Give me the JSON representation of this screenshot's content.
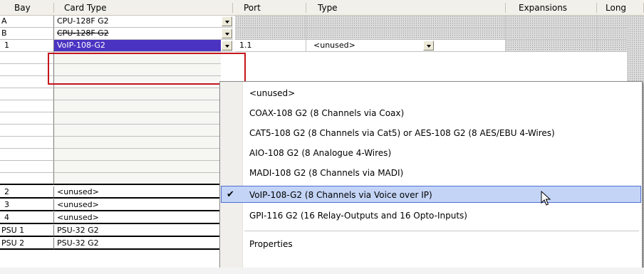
{
  "header": {
    "bay": "Bay",
    "card_type": "Card Type",
    "port": "Port",
    "type": "Type",
    "expansions": "Expansions",
    "long": "Long"
  },
  "bays": [
    {
      "bay": "A",
      "card": "CPU-128F G2"
    },
    {
      "bay": "B",
      "card": "CPU-128F G2"
    },
    {
      "bay": "1",
      "card": "VoIP-108-G2"
    },
    {
      "bay": "",
      "card": ""
    },
    {
      "bay": "",
      "card": ""
    },
    {
      "bay": "",
      "card": ""
    },
    {
      "bay": "",
      "card": ""
    },
    {
      "bay": "",
      "card": ""
    },
    {
      "bay": "",
      "card": ""
    },
    {
      "bay": "",
      "card": ""
    },
    {
      "bay": "2",
      "card": "<unused>"
    },
    {
      "bay": "3",
      "card": "<unused>"
    },
    {
      "bay": "4",
      "card": "<unused>"
    },
    {
      "bay": "PSU 1",
      "card": "PSU-32 G2"
    },
    {
      "bay": "PSU 2",
      "card": "PSU-32 G2"
    }
  ],
  "port_row": {
    "port": "1.1",
    "type": "<unused>"
  },
  "menu": {
    "items": [
      "<unused>",
      "COAX-108 G2 (8 Channels via Coax)",
      "CAT5-108 G2 (8 Channels via Cat5) or AES-108 G2 (8 AES/EBU 4-Wires)",
      "AIO-108 G2 (8 Analogue 4-Wires)",
      "MADI-108 G2 (8 Channels via MADI)",
      "VoIP-108-G2 (8 Channels via Voice over IP)",
      "GPI-116 G2 (16 Relay-Outputs and 16 Opto-Inputs)"
    ],
    "selected_index": 5,
    "check_glyph": "✔",
    "properties": "Properties"
  },
  "colors": {
    "selection": "#4b33c2",
    "menu_highlight": "#c3d4f6",
    "highlight_box": "#c4161c"
  }
}
